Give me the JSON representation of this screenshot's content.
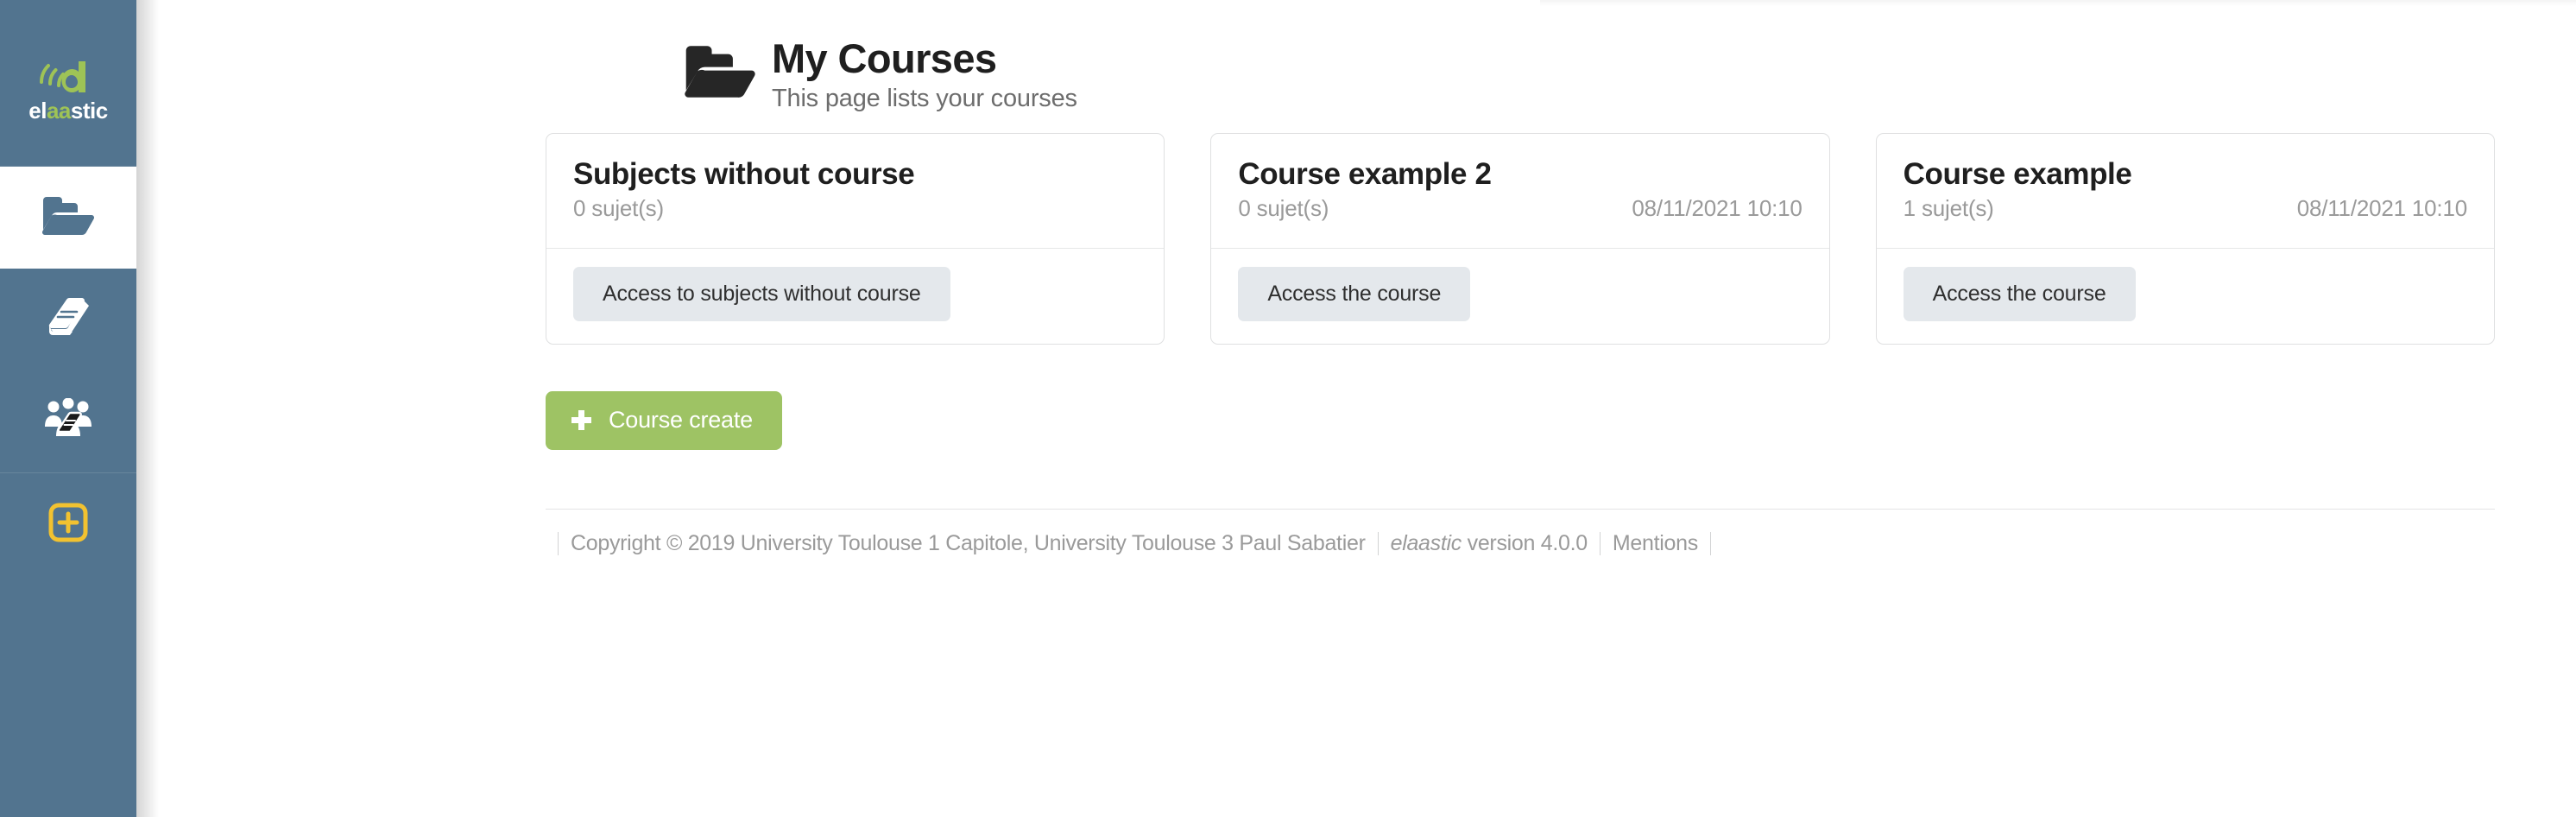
{
  "sidebar": {
    "brand": {
      "name": "elaastic",
      "part_pre": "el",
      "part_hl": "aa",
      "part_post": "stic",
      "logo_color": "#9ec356"
    },
    "items": [
      {
        "name": "courses",
        "icon": "open-folder-icon",
        "active": true
      },
      {
        "name": "subjects",
        "icon": "book-icon",
        "active": false
      },
      {
        "name": "shared-subjects",
        "icon": "users-book-icon",
        "active": false
      },
      {
        "name": "create",
        "icon": "plus-square-icon",
        "active": false,
        "color": "#f2c230"
      }
    ]
  },
  "page": {
    "icon": "open-folder-icon",
    "title": "My Courses",
    "subtitle": "This page lists your courses"
  },
  "cards": [
    {
      "title": "Subjects without course",
      "count": "0 sujet(s)",
      "date": "",
      "button": "Access to subjects without course"
    },
    {
      "title": "Course example 2",
      "count": "0 sujet(s)",
      "date": "08/11/2021 10:10",
      "button": "Access the course"
    },
    {
      "title": "Course example",
      "count": "1 sujet(s)",
      "date": "08/11/2021 10:10",
      "button": "Access the course"
    }
  ],
  "actions": {
    "create_label": "Course create",
    "create_icon": "plus-icon",
    "create_color": "#9ec364"
  },
  "footer": {
    "copyright": "Copyright © 2019 University Toulouse 1 Capitole, University Toulouse 3 Paul Sabatier",
    "product": "elaastic",
    "version": "version 4.0.0",
    "mentions": "Mentions"
  }
}
